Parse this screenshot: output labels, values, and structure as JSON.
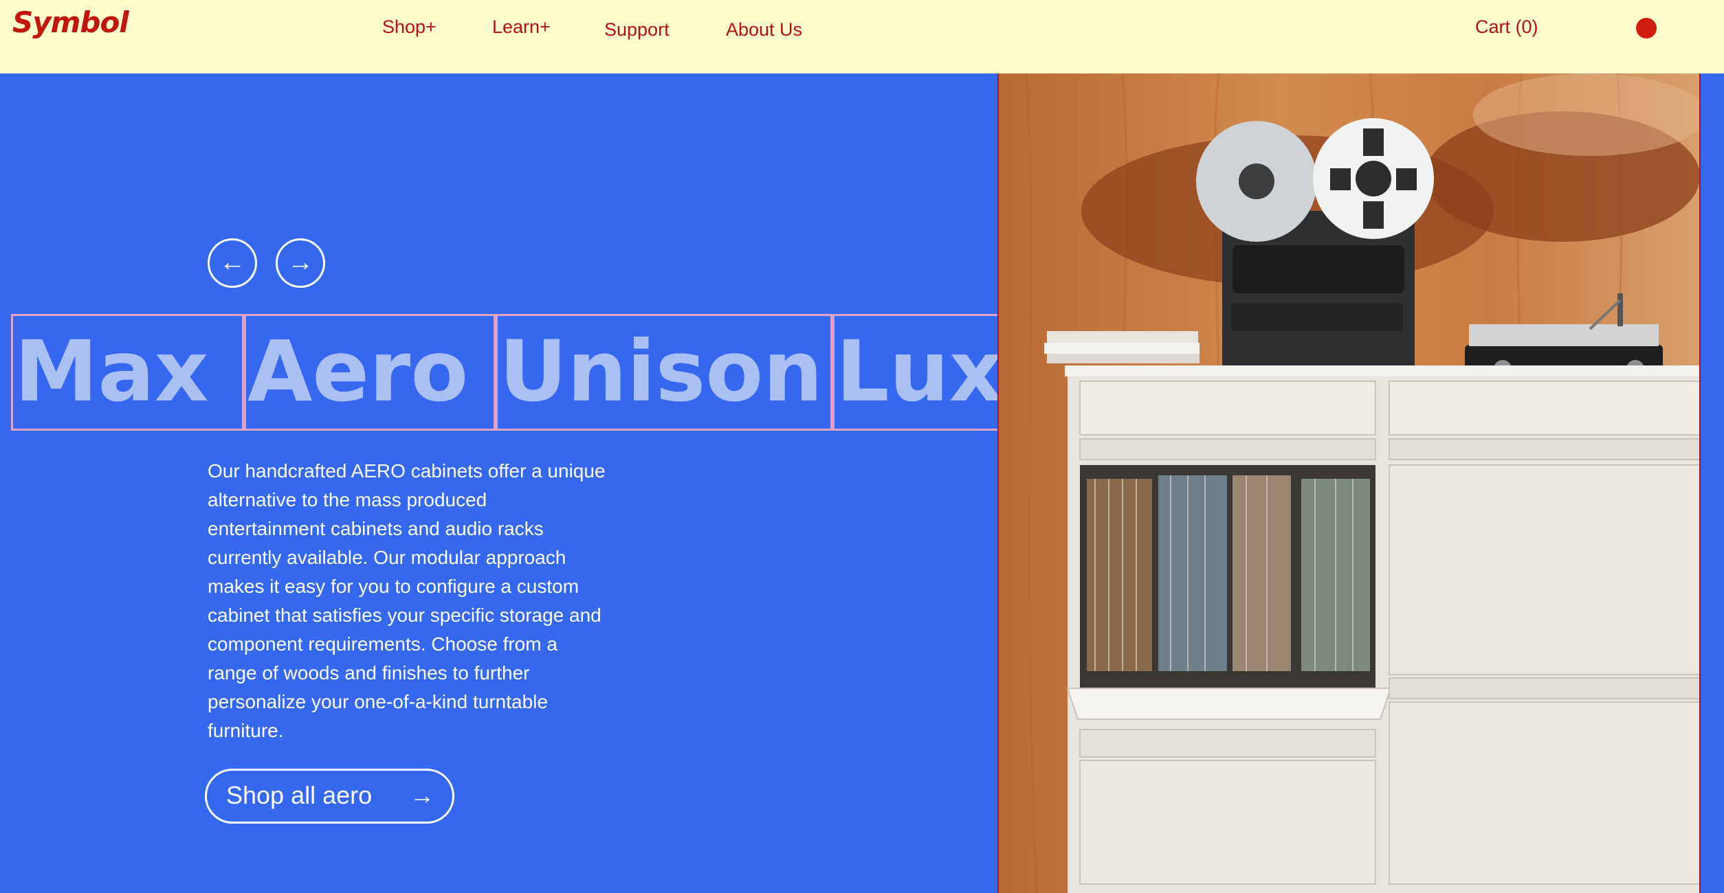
{
  "header": {
    "logo": "Symbol",
    "nav": [
      {
        "label": "Shop+"
      },
      {
        "label": "Learn+"
      },
      {
        "label": "Support"
      },
      {
        "label": "About Us"
      }
    ],
    "cart": "Cart (0)"
  },
  "carousel": {
    "prev_icon": "←",
    "next_icon": "→",
    "tabs": [
      {
        "label": "Max"
      },
      {
        "label": "Aero"
      },
      {
        "label": "Unison"
      },
      {
        "label": "Luxe"
      }
    ]
  },
  "content": {
    "description": "Our handcrafted AERO cabinets offer a unique alternative to the mass produced entertainment cabinets and audio racks currently available. Our modular approach makes it easy for you to configure a custom cabinet that satisfies your specific storage and component requirements. Choose from a range of woods and finishes to further personalize your one-of-a-kind turntable furniture.",
    "cta_label": "Shop all aero",
    "cta_icon": "→"
  },
  "colors": {
    "header_bg": "#fefbcd",
    "brand_red": "#b5120d",
    "panel_blue": "#3568ee",
    "tab_text": "#aabff2",
    "tab_border": "#dba3c9"
  }
}
